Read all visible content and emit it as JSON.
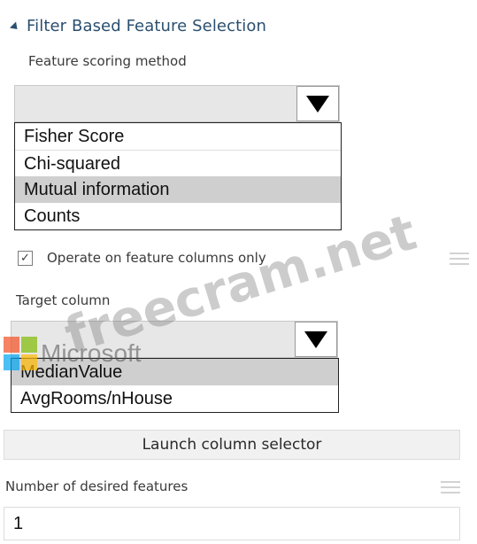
{
  "section": {
    "title": "Filter Based Feature Selection"
  },
  "scoring": {
    "label": "Feature scoring method",
    "options": [
      "Fisher Score",
      "Chi-squared",
      "Mutual information",
      "Counts"
    ],
    "selected_index": 2
  },
  "operate_checkbox": {
    "label": "Operate on feature columns only",
    "checked": true
  },
  "target": {
    "label": "Target column",
    "options": [
      "MedianValue",
      "AvgRooms/nHouse"
    ],
    "selected_index": 0
  },
  "launch_button": {
    "label": "Launch column selector"
  },
  "desired_features": {
    "label": "Number of desired features",
    "value": "1"
  },
  "watermark": {
    "site": "freecram.net",
    "brand": "Microsoft"
  },
  "colors": {
    "header_blue": "#2b4f6f",
    "ms_red": "#f25022",
    "ms_green": "#7fba00",
    "ms_blue": "#00a4ef",
    "ms_yellow": "#ffb900"
  }
}
